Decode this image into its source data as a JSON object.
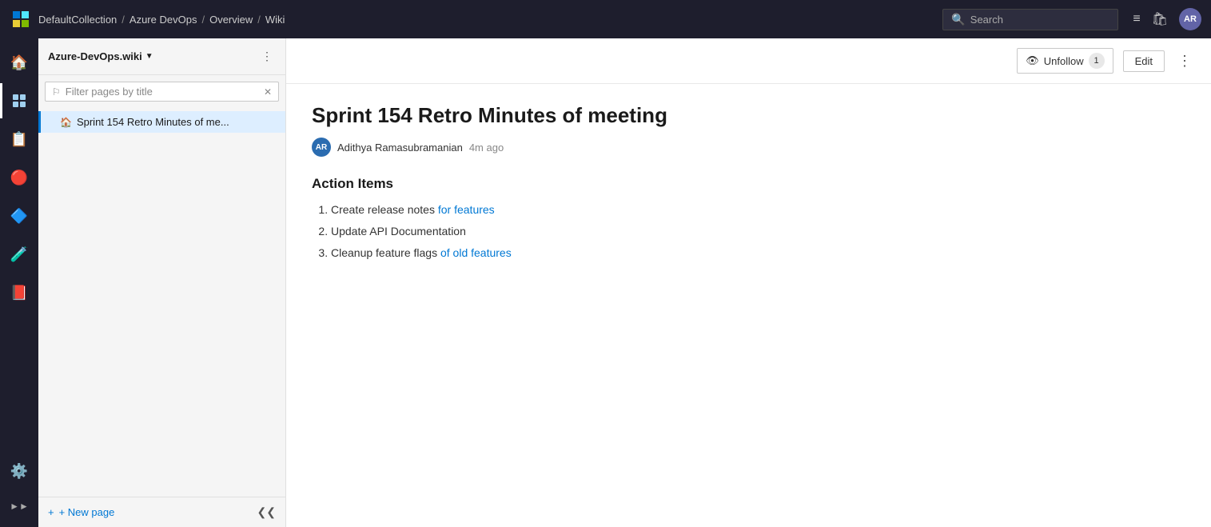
{
  "topNav": {
    "logoAlt": "Azure DevOps",
    "breadcrumb": [
      "DefaultCollection",
      "Azure DevOps",
      "Overview",
      "Wiki"
    ],
    "searchPlaceholder": "Search"
  },
  "avatarLabel": "AR",
  "sidebar": {
    "wikiTitle": "Azure-DevOps.wiki",
    "filterPlaceholder": "Filter pages by title",
    "treeItem": "Sprint 154 Retro Minutes of me...",
    "newPageLabel": "+ New page"
  },
  "content": {
    "pageTitle": "Sprint 154 Retro Minutes of meeting",
    "authorAvatar": "AR",
    "authorName": "Adithya Ramasubramanian",
    "authorTime": "4m ago",
    "unfollowLabel": "Unfollow",
    "followCount": "1",
    "editLabel": "Edit",
    "sectionHeading": "Action Items",
    "actionItems": [
      {
        "text": "Create release notes ",
        "linkText": "for features",
        "linkHref": "#"
      },
      {
        "text": "Update API Documentation",
        "linkText": "",
        "linkHref": ""
      },
      {
        "text": "Cleanup feature flags ",
        "linkText": "of old features",
        "linkHref": "#"
      }
    ]
  }
}
